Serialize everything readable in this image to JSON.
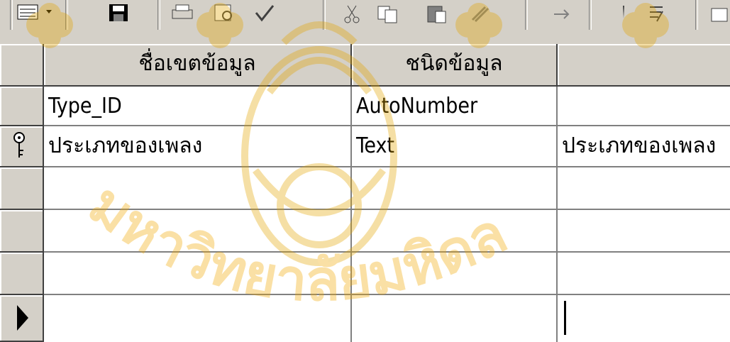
{
  "toolbar": {
    "buttons": [
      {
        "name": "view-icon"
      },
      {
        "name": "save-icon"
      },
      {
        "name": "print-icon"
      },
      {
        "name": "print-preview-icon"
      },
      {
        "name": "spelling-icon"
      },
      {
        "name": "cut-icon"
      },
      {
        "name": "copy-icon"
      },
      {
        "name": "paste-icon"
      },
      {
        "name": "format-painter-icon"
      },
      {
        "name": "undo-icon"
      },
      {
        "name": "primary-key-icon"
      },
      {
        "name": "indexes-icon"
      }
    ]
  },
  "table": {
    "columns": [
      "ชื่อเขตข้อมูล",
      "ชนิดข้อมูล",
      ""
    ],
    "rows": [
      {
        "field": "Type_ID",
        "type": "AutoNumber",
        "description": "",
        "primary_key": false
      },
      {
        "field": "ประเภทของเพลง",
        "type": "Text",
        "description": "ประเภทของเพลง",
        "primary_key": true
      },
      {
        "field": "",
        "type": "",
        "description": "",
        "primary_key": false
      },
      {
        "field": "",
        "type": "",
        "description": "",
        "primary_key": false
      },
      {
        "field": "",
        "type": "",
        "description": "",
        "primary_key": false
      },
      {
        "field": "",
        "type": "",
        "description": "",
        "primary_key": false,
        "current": true
      }
    ]
  },
  "watermark": {
    "text": "มหาวิทยาลัยมหิดล",
    "color": "#f2a900"
  },
  "colors": {
    "face": "#d4d0c8",
    "shadow": "#808080",
    "dark": "#404040"
  }
}
